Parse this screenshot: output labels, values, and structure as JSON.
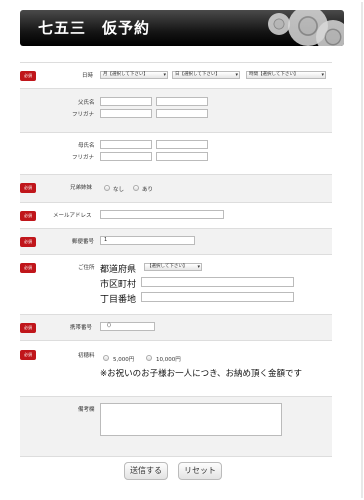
{
  "header": {
    "title": "七五三　仮予約"
  },
  "required_label": "必須",
  "date": {
    "label": "日時",
    "month": "月【選択して下さい】",
    "day": "日【選択して下さい】",
    "time": "時間【選択して下さい】"
  },
  "father": {
    "label": "父氏名",
    "kana_label": "フリガナ"
  },
  "mother": {
    "label": "母氏名",
    "kana_label": "フリガナ"
  },
  "siblings": {
    "label": "兄弟姉妹",
    "option_none": "なし",
    "option_yes": "あり"
  },
  "email": {
    "label": "メールアドレス",
    "value": ""
  },
  "postal": {
    "label": "郵便番号",
    "value": "1"
  },
  "address": {
    "label": "ご住所",
    "pref_label": "都道府県",
    "pref_select": "【選択して下さい】",
    "city_label": "市区町村",
    "street_label": "丁目番地"
  },
  "phone": {
    "label": "携帯番号",
    "value": "（）"
  },
  "fee": {
    "label": "初穂料",
    "option_5000": "5,000円",
    "option_10000": "10,000円",
    "note": "※お祝いのお子様お一人につき、お納め頂く金額です"
  },
  "remarks": {
    "label": "備考欄"
  },
  "buttons": {
    "submit": "送信する",
    "reset": "リセット"
  }
}
